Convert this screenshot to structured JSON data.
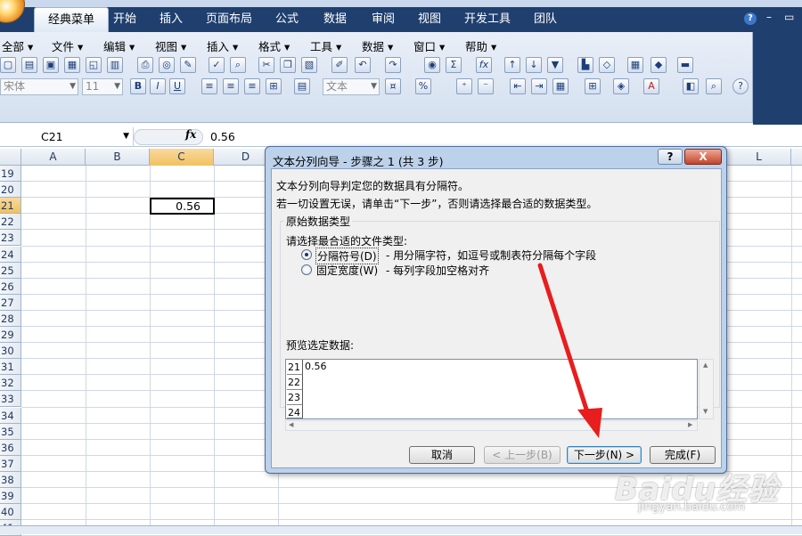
{
  "ribbon_tabs": [
    {
      "label": "经典菜单",
      "active": true
    },
    {
      "label": "开始"
    },
    {
      "label": "插入"
    },
    {
      "label": "页面布局"
    },
    {
      "label": "公式"
    },
    {
      "label": "数据"
    },
    {
      "label": "审阅"
    },
    {
      "label": "视图"
    },
    {
      "label": "开发工具"
    },
    {
      "label": "团队"
    }
  ],
  "window_controls": {
    "help": "?",
    "minimize": "–",
    "restore": "▭"
  },
  "classic_menu": [
    "全部",
    "文件",
    "编辑",
    "视图",
    "插入",
    "格式",
    "工具",
    "数据",
    "窗口",
    "帮助"
  ],
  "format_bar": {
    "font_name": "宋体",
    "font_size": "11",
    "number_format": "文本",
    "bold": "B",
    "italic": "I",
    "underline": "U",
    "percent": "%",
    "sum": "Σ",
    "fx": "fx"
  },
  "formula_bar": {
    "cell_ref": "C21",
    "fx_label": "fx",
    "content": "0.56"
  },
  "sheet": {
    "columns": [
      "A",
      "B",
      "C",
      "D",
      "L"
    ],
    "selected_column": "C",
    "rows": [
      "19",
      "20",
      "21",
      "22",
      "23",
      "24",
      "25",
      "26",
      "27",
      "28",
      "29",
      "30",
      "31",
      "32",
      "33",
      "34",
      "35",
      "36",
      "37",
      "38",
      "39",
      "40",
      "41"
    ],
    "selected_row": "21",
    "active_cell_value": "0.56"
  },
  "dialog": {
    "title": "文本分列向导 - 步骤之 1 (共 3 步)",
    "help_label": "?",
    "close_label": "X",
    "line1": "文本分列向导判定您的数据具有分隔符。",
    "line2": "若一切设置无误，请单击“下一步”，否则请选择最合适的数据类型。",
    "group_title": "原始数据类型",
    "group_prompt": "请选择最合适的文件类型:",
    "options": [
      {
        "label": "分隔符号(D)",
        "desc": "- 用分隔字符，如逗号或制表符分隔每个字段",
        "selected": true
      },
      {
        "label": "固定宽度(W)",
        "desc": "- 每列字段加空格对齐",
        "selected": false
      }
    ],
    "preview_label": "预览选定数据:",
    "preview_rows": [
      {
        "num": "21",
        "text": "0.56"
      },
      {
        "num": "22",
        "text": ""
      },
      {
        "num": "23",
        "text": ""
      },
      {
        "num": "24",
        "text": ""
      }
    ],
    "buttons": {
      "cancel": "取消",
      "back": "< 上一步(B)",
      "next": "下一步(N) >",
      "finish": "完成(F)"
    }
  },
  "watermark": {
    "brand": "Baidu经验",
    "url": "jingyan.baidu.com"
  },
  "colors": {
    "ribbon_dark": "#1f3f6e",
    "ribbon_light": "#dfe9f5",
    "dialog_frame": "#bcd1ea",
    "arrow": "#e81d1d",
    "selected_header": "#f1c15f"
  }
}
